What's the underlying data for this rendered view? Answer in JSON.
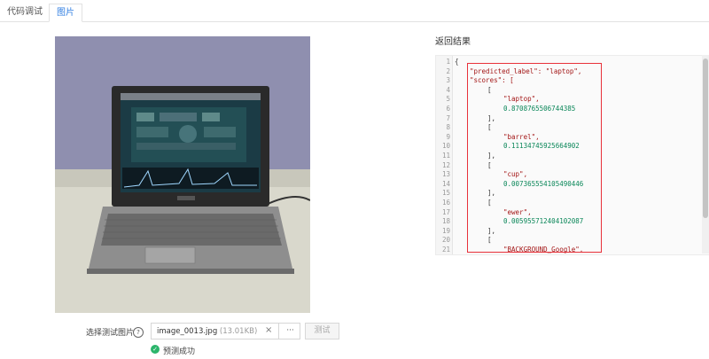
{
  "tabs": [
    {
      "label": "代码调试"
    },
    {
      "label": "图片"
    }
  ],
  "result": {
    "title": "返回结果",
    "line_numbers": [
      "1",
      "2",
      "3",
      "4",
      "5",
      "6",
      "7",
      "8",
      "9",
      "10",
      "11",
      "12",
      "13",
      "14",
      "15",
      "16",
      "17",
      "18",
      "19",
      "20",
      "21"
    ],
    "lines": [
      "{",
      "\"predicted_label\": \"laptop\",",
      "\"scores\": [",
      "[",
      "\"laptop\",",
      "0.8708765506744385",
      "],",
      "[",
      "\"barrel\",",
      "0.11134745925664902",
      "],",
      "[",
      "\"cup\",",
      "0.007365554105490446",
      "],",
      "[",
      "\"ewer\",",
      "0.005955712404102087",
      "],",
      "[",
      "\"BACKGROUND_Google\","
    ]
  },
  "form": {
    "label": "选择测试图片",
    "help_icon": "?",
    "file_name": "image_0013.jpg",
    "file_size": "(13.01KB)",
    "clear_icon": "×",
    "more_label": "···",
    "test_button": "测试",
    "status_icon": "✓",
    "status_text": "预测成功",
    "status_color": "#2bb56b"
  },
  "colors": {
    "accent": "#2f7de1",
    "highlight_border": "#e8313a"
  }
}
